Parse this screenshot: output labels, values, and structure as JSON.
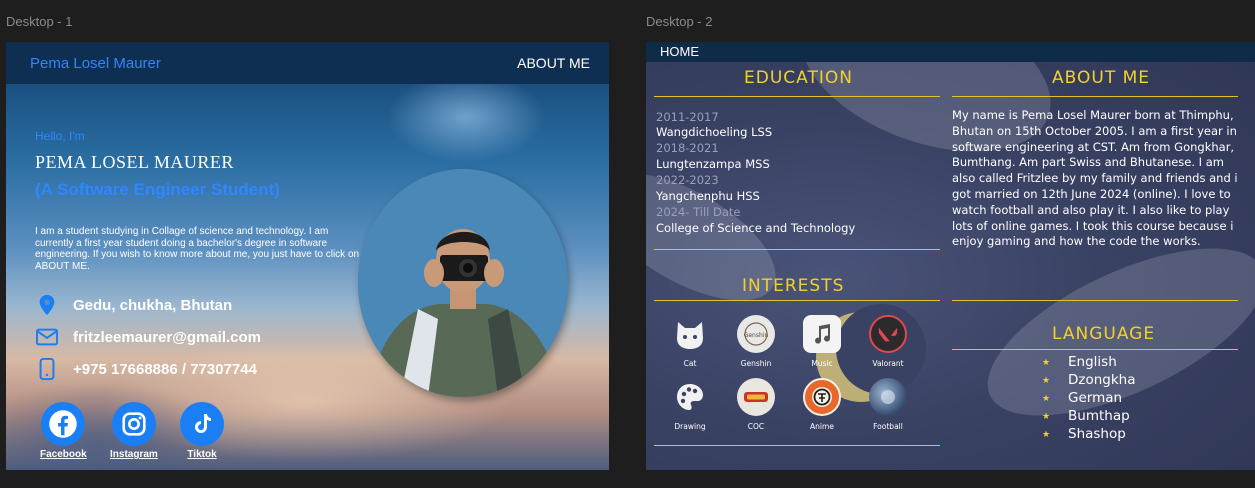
{
  "frames": {
    "desktop1_label": "Desktop - 1",
    "desktop2_label": "Desktop - 2"
  },
  "colors": {
    "canvas_bg": "#1e1e1e",
    "accent_blue": "#2f86ff",
    "nav_bg": "#0f2f52",
    "heading_yellow": "#f4d12a"
  },
  "desktop1": {
    "nav": {
      "name": "Pema Losel Maurer",
      "about_link": "ABOUT ME"
    },
    "hello": "Hello, I'm",
    "full_name": "PEMA LOSEL MAURER",
    "role": "(A Software Engineer Student)",
    "bio": "I am a student studying in Collage of science and technology. I am currently a first year student doing a bachelor's degree in software engineering. If you wish to know more about me, you just have to click on ABOUT ME.",
    "contacts": [
      {
        "icon": "location-pin-icon",
        "text": "Gedu, chukha, Bhutan"
      },
      {
        "icon": "mail-icon",
        "text": "fritzleemaurer@gmail.com"
      },
      {
        "icon": "phone-icon",
        "text": "+975 17668886 / 77307744"
      }
    ],
    "socials": [
      {
        "icon": "facebook-icon",
        "label": "Facebook"
      },
      {
        "icon": "instagram-icon",
        "label": "Instagram"
      },
      {
        "icon": "tiktok-icon",
        "label": "Tiktok"
      }
    ]
  },
  "desktop2": {
    "nav": {
      "home": "HOME"
    },
    "education": {
      "heading": "EDUCATION",
      "entries": [
        {
          "years": "2011-2017",
          "school": "Wangdichoeling LSS"
        },
        {
          "years": "2018-2021",
          "school": "Lungtenzampa MSS"
        },
        {
          "years": "2022-2023",
          "school": "Yangchenphu HSS"
        },
        {
          "years": "2024- Till Date",
          "school": "College of Science and Technology"
        }
      ]
    },
    "about": {
      "heading": "ABOUT ME",
      "text": "My name is Pema Losel Maurer born at Thimphu, Bhutan on 15th October 2005. I am a first year in software engineering at CST. Am from Gongkhar, Bumthang. Am part Swiss and Bhutanese. I am also called Fritzlee by my family and friends and i got married on 12th June 2024 (online). I love to watch football and also play it. I also like to play lots of online games. I took this course because i enjoy gaming and how the code the works."
    },
    "interests": {
      "heading": "INTERESTS",
      "items": [
        {
          "icon": "cat-icon",
          "label": "Cat"
        },
        {
          "icon": "genshin-icon",
          "label": "Genshin"
        },
        {
          "icon": "music-icon",
          "label": "Music"
        },
        {
          "icon": "valorant-icon",
          "label": "Valorant"
        },
        {
          "icon": "palette-icon",
          "label": "Drawing"
        },
        {
          "icon": "coc-icon",
          "label": "COC"
        },
        {
          "icon": "anime-icon",
          "label": "Anime"
        },
        {
          "icon": "football-icon",
          "label": "Football"
        }
      ]
    },
    "language": {
      "heading": "LANGUAGE",
      "items": [
        "English",
        "Dzongkha",
        "German",
        "Bumthap",
        "Shashop"
      ]
    }
  }
}
